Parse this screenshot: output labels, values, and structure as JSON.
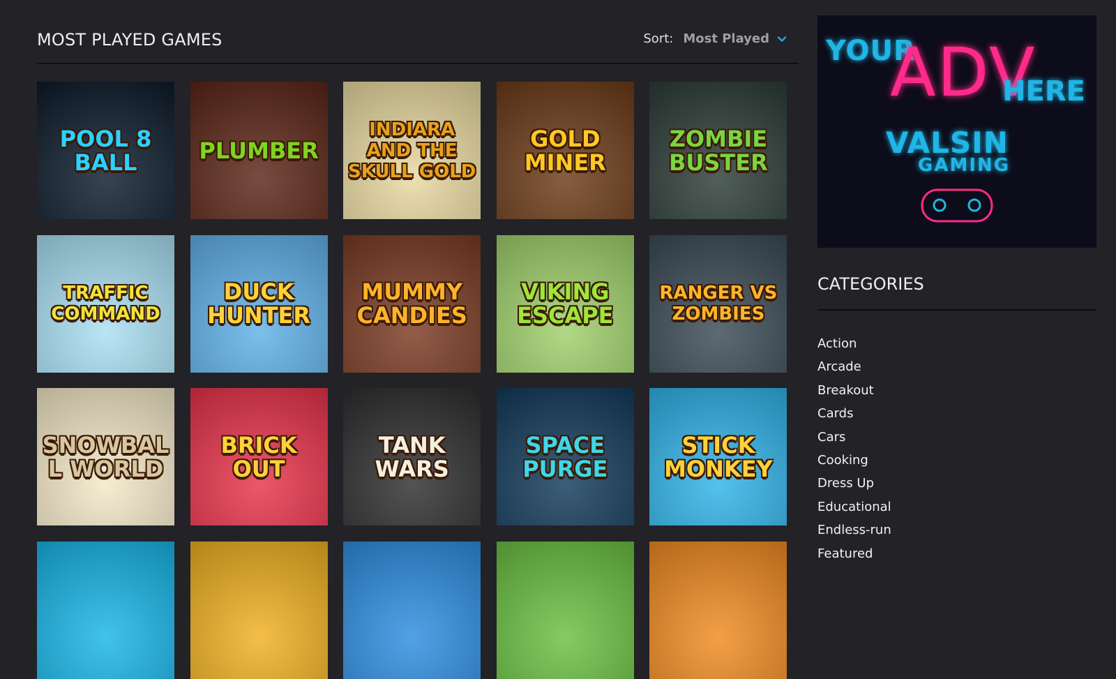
{
  "main": {
    "title": "MOST PLAYED GAMES",
    "sort_label": "Sort:",
    "sort_value": "Most Played"
  },
  "games": [
    {
      "title": "POOL 8 BALL",
      "bg": "#0c1a2b",
      "accent": "#2bd1ff"
    },
    {
      "title": "PLUMBER",
      "bg": "#5a2416",
      "accent": "#7fd321"
    },
    {
      "title": "INDIARA AND THE SKULL GOLD",
      "bg": "#e8d9a0",
      "accent": "#e8a21b"
    },
    {
      "title": "GOLD MINER",
      "bg": "#6b3a17",
      "accent": "#ffc825"
    },
    {
      "title": "ZOMBIE BUSTER",
      "bg": "#2b3b35",
      "accent": "#7bd440"
    },
    {
      "title": "TRAFFIC COMMAND",
      "bg": "#a9dff2",
      "accent": "#f2e33a"
    },
    {
      "title": "DUCK HUNTER",
      "bg": "#5fb0e8",
      "accent": "#ffd23a"
    },
    {
      "title": "MUMMY Candies",
      "bg": "#7a3a22",
      "accent": "#ffb32a"
    },
    {
      "title": "VIKING ESCAPE",
      "bg": "#9fd06a",
      "accent": "#9ee63a"
    },
    {
      "title": "RANGER VS ZOMBIES",
      "bg": "#3a4a55",
      "accent": "#ffb52a"
    },
    {
      "title": "SNOWBALL WORLD",
      "bg": "#f4e8c8",
      "accent": "#d7c7a0"
    },
    {
      "title": "BRICK OUT",
      "bg": "#e8324a",
      "accent": "#ffd23a"
    },
    {
      "title": "TANK WARS",
      "bg": "#2d2d2d",
      "accent": "#f4f0e0"
    },
    {
      "title": "SPACE PURGE",
      "bg": "#123a5a",
      "accent": "#3fd6e8"
    },
    {
      "title": "STICK MONKEY",
      "bg": "#2fb3e8",
      "accent": "#ffd23a"
    },
    {
      "title": "",
      "bg": "#17b5e8",
      "accent": "#ffffff"
    },
    {
      "title": "",
      "bg": "#f0b020",
      "accent": "#ffffff"
    },
    {
      "title": "",
      "bg": "#2d8de0",
      "accent": "#ffffff"
    },
    {
      "title": "",
      "bg": "#69c040",
      "accent": "#ffffff"
    },
    {
      "title": "",
      "bg": "#f08a20",
      "accent": "#ffffff"
    }
  ],
  "ad": {
    "your": "YOUR",
    "adv": "ADV",
    "here": "HERE",
    "brand": "VALSIN",
    "brand_sub": "GAMING"
  },
  "sidebar": {
    "categories_title": "CATEGORIES",
    "categories": [
      "Action",
      "Arcade",
      "Breakout",
      "Cards",
      "Cars",
      "Cooking",
      "Dress Up",
      "Educational",
      "Endless-run",
      "Featured"
    ]
  },
  "colors": {
    "background": "#222227",
    "accent": "#1ea7dc"
  }
}
